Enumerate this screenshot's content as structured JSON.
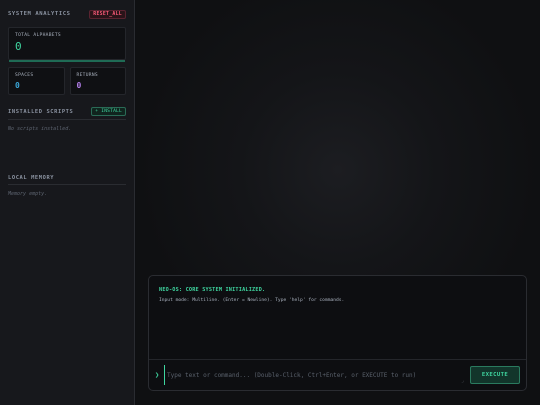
{
  "sidebar": {
    "title": "SYSTEM ANALYTICS",
    "reset_label": "RESET_ALL",
    "total": {
      "label": "TOTAL ALPHABETS",
      "value": "0"
    },
    "spaces": {
      "label": "SPACES",
      "value": "0"
    },
    "returns": {
      "label": "RETURNS",
      "value": "0"
    },
    "scripts": {
      "title": "INSTALLED SCRIPTS",
      "install_label": "+ INSTALL",
      "empty": "No scripts installed."
    },
    "memory": {
      "title": "LOCAL MEMORY",
      "empty": "Memory empty."
    }
  },
  "console": {
    "line1": "NEO-OS: CORE SYSTEM INITIALIZED.",
    "line2": "Input mode: Multiline. (Enter = Newline). Type 'help' for commands.",
    "prompt_symbol": "❯",
    "placeholder": "Type text or command... (Double-Click, Ctrl+Enter, or EXECUTE to run)",
    "execute_label": "EXECUTE",
    "resize_glyph": "⌟"
  },
  "colors": {
    "accent": "#3fd6a0",
    "danger": "#ff5c7a",
    "blue": "#3aa6d8",
    "purple": "#b37feb"
  }
}
